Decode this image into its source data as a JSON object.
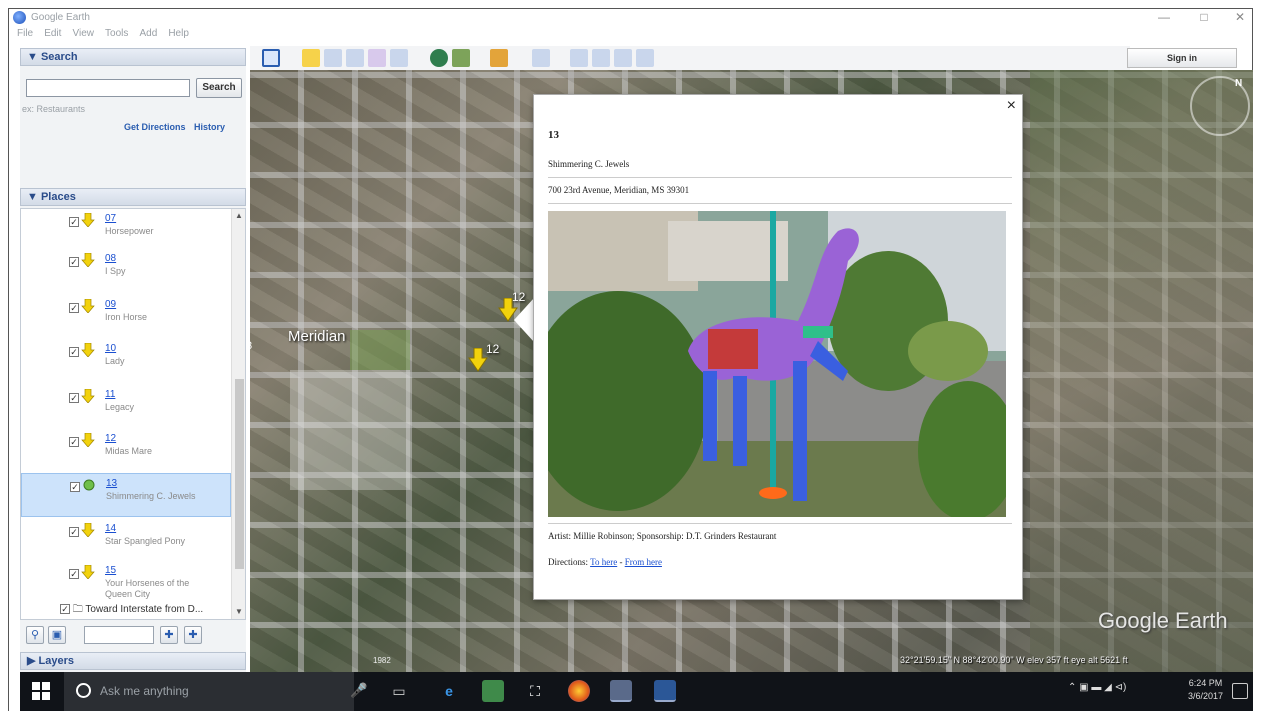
{
  "window": {
    "title": "Google Earth"
  },
  "menu": [
    "File",
    "Edit",
    "View",
    "Tools",
    "Add",
    "Help"
  ],
  "search": {
    "header": "▼ Search",
    "placeholder": "",
    "button": "Search",
    "hint": "ex: Restaurants",
    "get_directions": "Get Directions",
    "history": "History"
  },
  "places": {
    "header": "▼ Places",
    "items": [
      {
        "num": "07",
        "name": "Horsepower"
      },
      {
        "num": "08",
        "name": "I Spy"
      },
      {
        "num": "09",
        "name": "Iron Horse"
      },
      {
        "num": "10",
        "name": "Lady"
      },
      {
        "num": "11",
        "name": "Legacy"
      },
      {
        "num": "12",
        "name": "Midas Mare"
      },
      {
        "num": "13",
        "name": "Shimmering C. Jewels",
        "selected": true
      },
      {
        "num": "14",
        "name": "Star Spangled Pony"
      },
      {
        "num": "15",
        "name": "Your Horsenes of the Queen City"
      }
    ],
    "folder": "Toward Interstate from D..."
  },
  "layers": {
    "header": "▶ Layers"
  },
  "sign_in": "Sign in",
  "map": {
    "city_label": "Meridian",
    "pin_labels": [
      "12",
      "12"
    ],
    "edge_label": "3",
    "status": "32°21'59.15\" N  88°42'00.90\" W  elev  357 ft    eye alt  5621 ft",
    "date_label": "1982",
    "logo": "Google Earth",
    "compass_n": "N"
  },
  "balloon": {
    "close": "×",
    "title": "13",
    "name": "Shimmering C. Jewels",
    "address": "700 23rd Avenue, Meridian, MS 39301",
    "caption": "Artist: Millie Robinson; Sponsorship: D.T. Grinders Restaurant",
    "directions_label": "Directions:",
    "to_here": "To here",
    "sep": " - ",
    "from_here": "From here"
  },
  "taskbar": {
    "cortana": "Ask me anything",
    "time": "6:24 PM",
    "date": "3/6/2017"
  },
  "colors": {
    "accent": "#2a5db0",
    "link": "#1a4fd0",
    "taskbar": "#101318",
    "selected_row": "#cde3fb"
  }
}
